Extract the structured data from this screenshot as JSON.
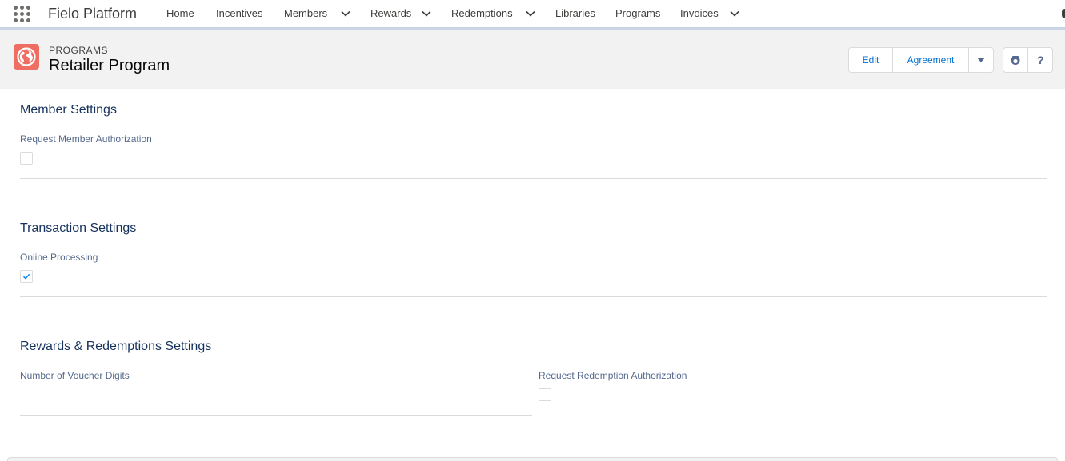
{
  "nav": {
    "app_name": "Fielo Platform",
    "items": [
      {
        "label": "Home",
        "has_menu": false
      },
      {
        "label": "Incentives",
        "has_menu": false
      },
      {
        "label": "Members",
        "has_menu": true
      },
      {
        "label": "Rewards",
        "has_menu": true
      },
      {
        "label": "Redemptions",
        "has_menu": true
      },
      {
        "label": "Libraries",
        "has_menu": false
      },
      {
        "label": "Programs",
        "has_menu": false
      },
      {
        "label": "Invoices",
        "has_menu": true
      }
    ],
    "icons": {
      "launcher": "app-launcher-icon",
      "menu": "chevron-down-icon"
    }
  },
  "record": {
    "entity": "Programs",
    "title": "Retailer Program",
    "icon": "globe-icon",
    "icon_color": "#ef6e64",
    "actions": {
      "edit": "Edit",
      "agreement": "Agreement",
      "more": "caret-down-icon"
    },
    "utilities": {
      "follow": "follow-icon",
      "help": "?"
    }
  },
  "sections": {
    "member": {
      "title": "Member Settings",
      "fields": [
        {
          "label": "Request Member Authorization",
          "checked": false
        }
      ]
    },
    "transaction": {
      "title": "Transaction Settings",
      "fields": [
        {
          "label": "Online Processing",
          "checked": true
        }
      ]
    },
    "rewards": {
      "title": "Rewards & Redemptions Settings",
      "fields": [
        {
          "label": "Number of Voucher Digits",
          "value": ""
        },
        {
          "label": "Request Redemption Authorization",
          "checked": false
        }
      ]
    }
  },
  "colors": {
    "link": "#0070d2",
    "heading": "#16325c",
    "label": "#54698d",
    "border": "#dddbda"
  }
}
